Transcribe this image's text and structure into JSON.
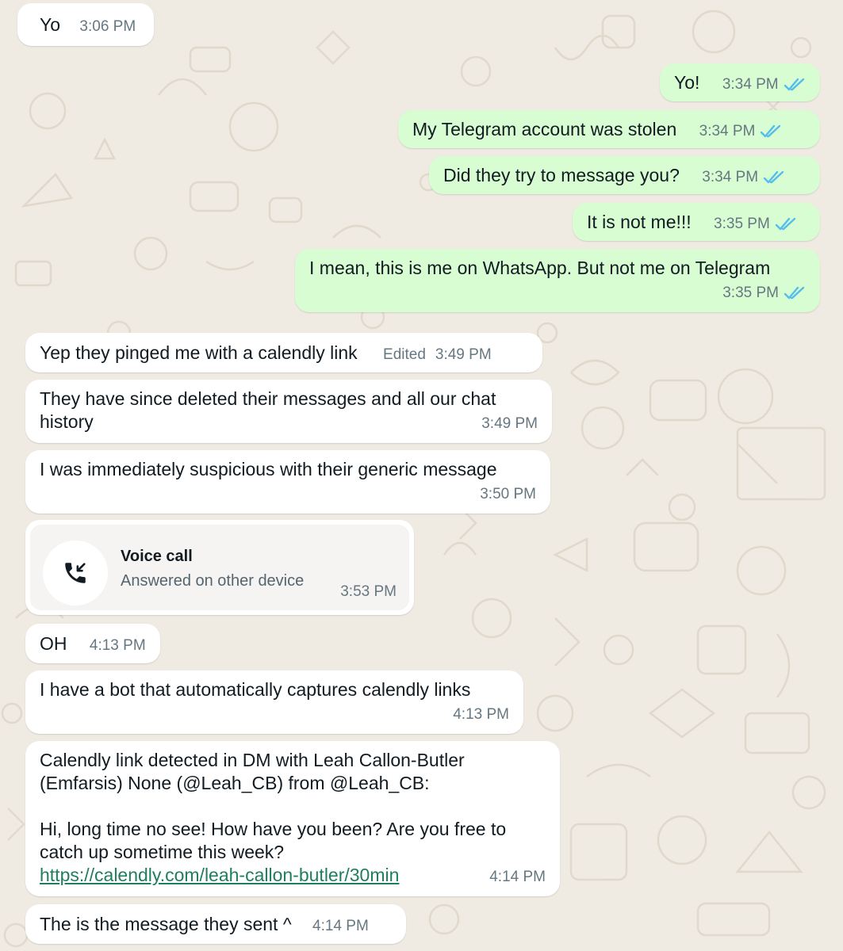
{
  "colors": {
    "incoming_bg": "#ffffff",
    "outgoing_bg": "#d9fdd3",
    "read_tick": "#53bdeb",
    "link": "#1f7e5c",
    "wallpaper": "#efeae2"
  },
  "messages": [
    {
      "dir": "in",
      "text": "Yo",
      "time": "3:06 PM"
    },
    {
      "dir": "out",
      "text": "Yo!",
      "time": "3:34 PM",
      "status": "read"
    },
    {
      "dir": "out",
      "text": "My Telegram account was stolen",
      "time": "3:34 PM",
      "status": "read"
    },
    {
      "dir": "out",
      "text": "Did they try to message you?",
      "time": "3:34 PM",
      "status": "read"
    },
    {
      "dir": "out",
      "text": "It is not me!!!",
      "time": "3:35 PM",
      "status": "read"
    },
    {
      "dir": "out",
      "text": "I mean, this is me on WhatsApp. But not me on Telegram",
      "time": "3:35 PM",
      "status": "read"
    },
    {
      "dir": "in",
      "text": "Yep they pinged me with a calendly link",
      "edited_label": "Edited",
      "time": "3:49 PM"
    },
    {
      "dir": "in",
      "text": "They have since deleted their messages and all our chat history",
      "time": "3:49 PM"
    },
    {
      "dir": "in",
      "text": "I was immediately suspicious with their generic message",
      "time": "3:50 PM"
    },
    {
      "dir": "in",
      "type": "call",
      "icon": "incoming-call-icon",
      "title": "Voice call",
      "subtitle": "Answered on other device",
      "time": "3:53 PM"
    },
    {
      "dir": "in",
      "text": "OH",
      "time": "4:13 PM"
    },
    {
      "dir": "in",
      "text": "I have a bot that automatically captures calendly links",
      "time": "4:13 PM"
    },
    {
      "dir": "in",
      "text": "Calendly link detected in DM with Leah Callon-Butler (Emfarsis) None (@Leah_CB) from @Leah_CB:\n\nHi, long time no see! How have you been? Are you free to catch up sometime this week?",
      "link": "https://calendly.com/leah-callon-butler/30min",
      "time": "4:14 PM"
    },
    {
      "dir": "in",
      "text": "The is the message they sent ^",
      "time": "4:14 PM"
    }
  ]
}
